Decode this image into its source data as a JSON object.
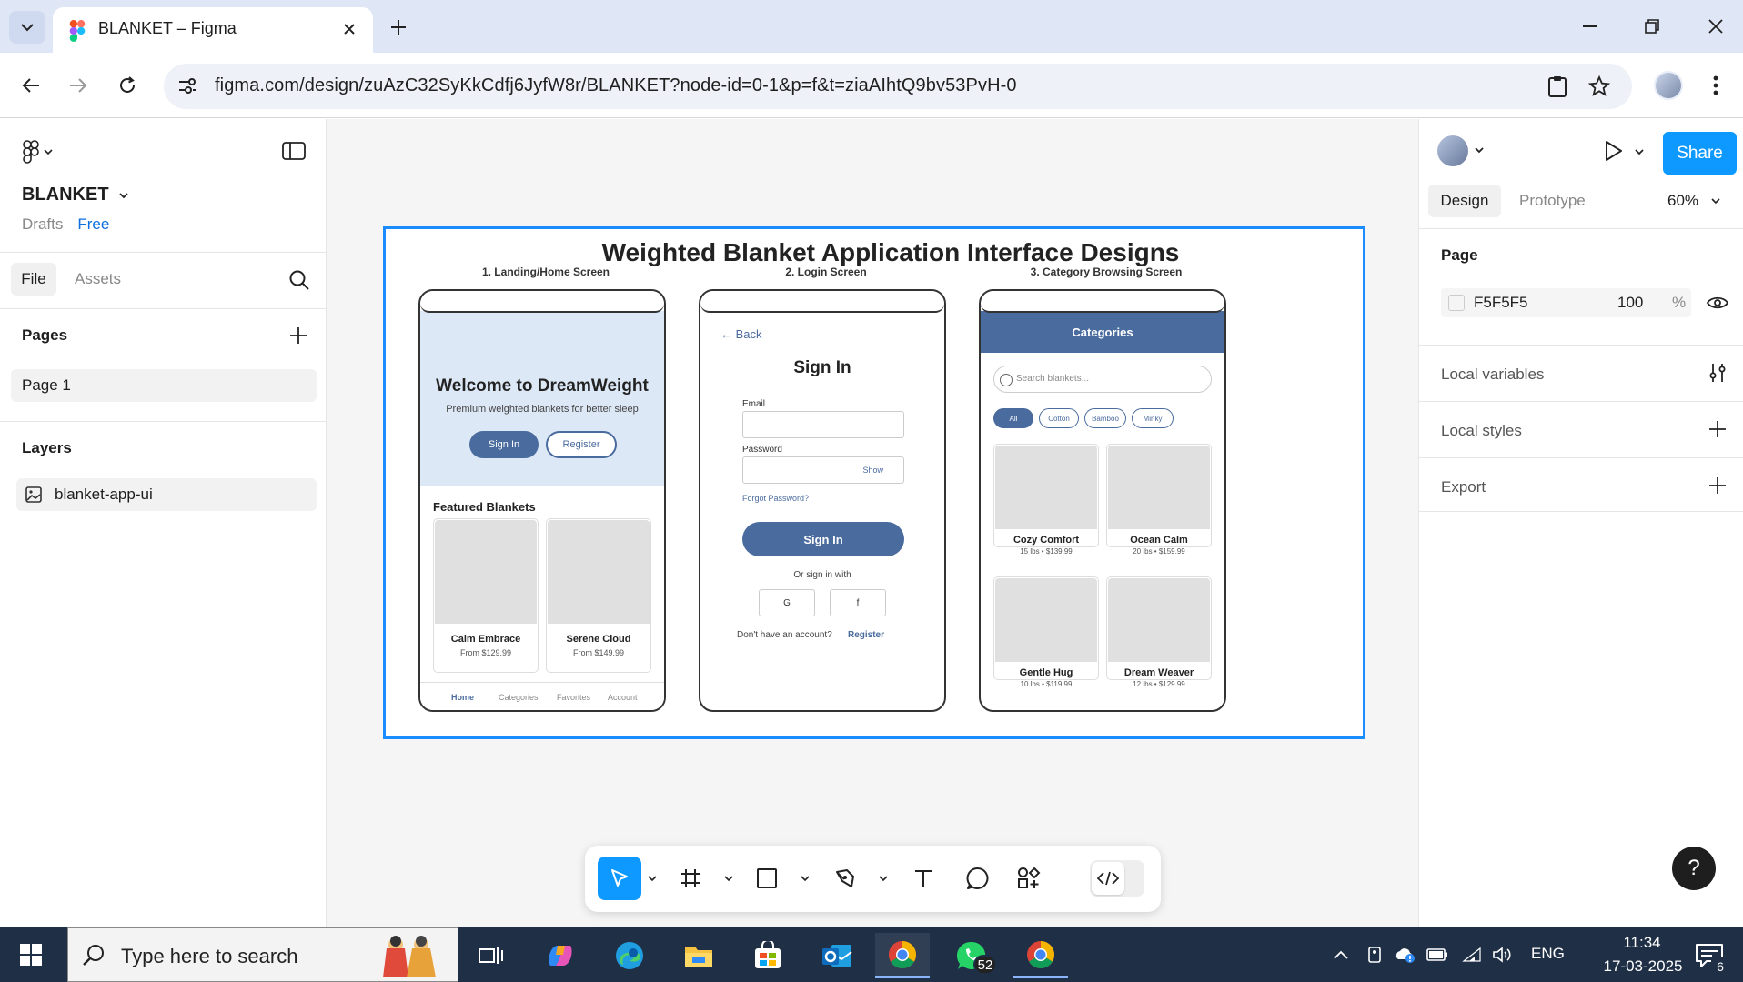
{
  "browser": {
    "tab_title": "BLANKET – Figma",
    "url": "figma.com/design/zuAzC32SyKkCdfj6JyfW8r/BLANKET?node-id=0-1&p=f&t=ziaAIhtQ9bv53PvH-0"
  },
  "left_panel": {
    "file_name": "BLANKET",
    "drafts_label": "Drafts",
    "plan_label": "Free",
    "tabs": {
      "file": "File",
      "assets": "Assets"
    },
    "pages_title": "Pages",
    "pages": [
      {
        "label": "Page 1"
      }
    ],
    "layers_title": "Layers",
    "layers": [
      {
        "label": "blanket-app-ui"
      }
    ]
  },
  "canvas": {
    "frame_title": "Weighted Blanket Application Interface Designs",
    "screen_labels": [
      "1. Landing/Home Screen",
      "2. Login Screen",
      "3. Category Browsing Screen"
    ],
    "home": {
      "welcome": "Welcome to DreamWeight",
      "tagline": "Premium weighted blankets for better sleep",
      "signin": "Sign In",
      "register": "Register",
      "featured_title": "Featured Blankets",
      "products": [
        {
          "name": "Calm Embrace",
          "price": "From $129.99"
        },
        {
          "name": "Serene Cloud",
          "price": "From $149.99"
        }
      ],
      "nav": [
        "Home",
        "Categories",
        "Favorites",
        "Account"
      ]
    },
    "login": {
      "back": "← Back",
      "title": "Sign In",
      "email_label": "Email",
      "password_label": "Password",
      "show": "Show",
      "forgot": "Forgot Password?",
      "signin": "Sign In",
      "or": "Or sign in with",
      "google": "G",
      "facebook": "f",
      "no_account": "Don't have an account?",
      "register": "Register"
    },
    "categories": {
      "title": "Categories",
      "search_placeholder": "Search blankets...",
      "chips": [
        "All",
        "Cotton",
        "Bamboo",
        "Minky"
      ],
      "products": [
        {
          "name": "Cozy Comfort",
          "meta": "15 lbs • $139.99"
        },
        {
          "name": "Ocean Calm",
          "meta": "20 lbs • $159.99"
        },
        {
          "name": "Gentle Hug",
          "meta": "10 lbs • $119.99"
        },
        {
          "name": "Dream Weaver",
          "meta": "12 lbs • $129.99"
        }
      ]
    }
  },
  "right_panel": {
    "share": "Share",
    "tabs": {
      "design": "Design",
      "prototype": "Prototype"
    },
    "zoom": "60%",
    "page_title": "Page",
    "background_hex": "F5F5F5",
    "background_opacity": "100",
    "percent_sign": "%",
    "rows": [
      "Local variables",
      "Local styles",
      "Export"
    ],
    "help": "?"
  },
  "taskbar": {
    "search_placeholder": "Type here to search",
    "whatsapp_badge": "52",
    "language": "ENG",
    "time": "11:34",
    "date": "17-03-2025",
    "notifications": "6"
  },
  "colors": {
    "accent_blue": "#0d99ff",
    "frame_blue": "#1a8cff",
    "app_primary": "#4a6b9e",
    "hero_bg": "#dde8f6",
    "canvas_bg": "#f5f5f5"
  }
}
